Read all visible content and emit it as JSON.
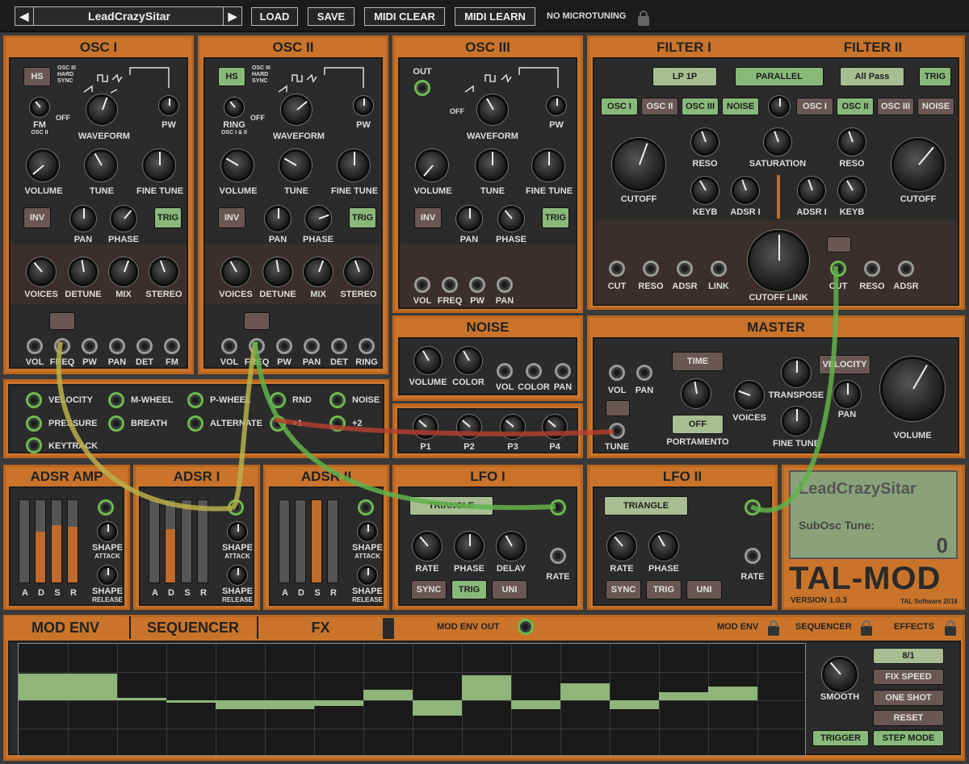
{
  "top": {
    "preset": "LeadCrazySitar",
    "load": "LOAD",
    "save": "SAVE",
    "midi_clear": "MIDI CLEAR",
    "midi_learn": "MIDI LEARN",
    "microtuning": "NO MICROTUNING",
    "prev": "◀",
    "next": "▶"
  },
  "osc1": {
    "title": "OSC I",
    "hs": "HS",
    "osc3sync": "OSC III HARD SYNC",
    "fm": "FM",
    "fm_sub": "OSC II",
    "waveform": "WAVEFORM",
    "off": "OFF",
    "pw": "PW",
    "volume": "VOLUME",
    "tune": "TUNE",
    "fine": "FINE TUNE",
    "inv": "INV",
    "pan": "PAN",
    "phase": "PHASE",
    "trig": "TRIG",
    "voices": "VOICES",
    "detune": "DETUNE",
    "mix": "MIX",
    "stereo": "STEREO",
    "j": [
      "VOL",
      "FREQ",
      "PW",
      "PAN",
      "DET",
      "FM"
    ]
  },
  "osc2": {
    "title": "OSC II",
    "hs": "HS",
    "osc3sync": "OSC III HARD SYNC",
    "ring": "RING",
    "ring_sub": "OSC I & II",
    "waveform": "WAVEFORM",
    "off": "OFF",
    "pw": "PW",
    "volume": "VOLUME",
    "tune": "TUNE",
    "fine": "FINE TUNE",
    "inv": "INV",
    "pan": "PAN",
    "phase": "PHASE",
    "trig": "TRIG",
    "voices": "VOICES",
    "detune": "DETUNE",
    "mix": "MIX",
    "stereo": "STEREO",
    "j": [
      "VOL",
      "FREQ",
      "PW",
      "PAN",
      "DET",
      "RING"
    ]
  },
  "osc3": {
    "title": "OSC III",
    "out": "OUT",
    "waveform": "WAVEFORM",
    "off": "OFF",
    "pw": "PW",
    "volume": "VOLUME",
    "tune": "TUNE",
    "fine": "FINE TUNE",
    "inv": "INV",
    "pan": "PAN",
    "phase": "PHASE",
    "trig": "TRIG",
    "j": [
      "VOL",
      "FREQ",
      "PW",
      "PAN"
    ]
  },
  "noise": {
    "title": "NOISE",
    "volume": "VOLUME",
    "color": "COLOR",
    "j": [
      "VOL",
      "COLOR",
      "PAN"
    ]
  },
  "filter": {
    "title1": "FILTER I",
    "title2": "FILTER II",
    "lp": "LP 1P",
    "parallel": "PARALLEL",
    "allpass": "All Pass",
    "trig": "TRIG",
    "src": [
      "OSC I",
      "OSC II",
      "OSC III",
      "NOISE"
    ],
    "reso": "RESO",
    "saturation": "SATURATION",
    "cutoff": "CUTOFF",
    "keyb": "KEYB",
    "adsr1": "ADSR I",
    "cutoff_link": "CUTOFF LINK",
    "j1": [
      "CUT",
      "RESO",
      "ADSR",
      "LINK"
    ],
    "j2": [
      "CUT",
      "RESO",
      "ADSR"
    ]
  },
  "mods": {
    "items": [
      "VELOCITY",
      "M-WHEEL",
      "P-WHEEL",
      "RND",
      "NOISE",
      "PRESSURE",
      "BREATH",
      "ALTERNATE",
      "+1",
      "+2",
      "KEYTRACK"
    ]
  },
  "params": {
    "p": [
      "P1",
      "P2",
      "P3",
      "P4"
    ]
  },
  "master": {
    "title": "MASTER",
    "vol": "VOL",
    "pan": "PAN",
    "time": "TIME",
    "velocity": "VELOCITY",
    "voices": "VOICES",
    "transpose": "TRANSPOSE",
    "off": "OFF",
    "portamento": "PORTAMENTO",
    "fine": "FINE TUNE",
    "tune": "TUNE",
    "volume": "VOLUME",
    "pan2": "PAN"
  },
  "adsr_amp": {
    "title": "ADSR AMP",
    "labels": [
      "A",
      "D",
      "S",
      "R"
    ],
    "shape_a": "SHAPE",
    "attack": "ATTACK",
    "shape_r": "SHAPE",
    "release": "RELEASE",
    "levels": [
      0,
      0.62,
      0.7,
      0.68
    ]
  },
  "adsr1": {
    "title": "ADSR I",
    "labels": [
      "A",
      "D",
      "S",
      "R"
    ],
    "shape_a": "SHAPE",
    "attack": "ATTACK",
    "shape_r": "SHAPE",
    "release": "RELEASE",
    "levels": [
      0,
      0.65,
      0.0,
      0.0
    ]
  },
  "adsr2": {
    "title": "ADSR II",
    "labels": [
      "A",
      "D",
      "S",
      "R"
    ],
    "shape_a": "SHAPE",
    "attack": "ATTACK",
    "shape_r": "SHAPE",
    "release": "RELEASE",
    "levels": [
      0,
      0,
      1.0,
      0
    ]
  },
  "lfo1": {
    "title": "LFO I",
    "wave": "TRIANGLE",
    "rate": "RATE",
    "phase": "PHASE",
    "delay": "DELAY",
    "rate2": "RATE",
    "sync": "SYNC",
    "trig": "TRIG",
    "uni": "UNI"
  },
  "lfo2": {
    "title": "LFO II",
    "wave": "TRIANGLE",
    "rate": "RATE",
    "phase": "PHASE",
    "rate2": "RATE",
    "sync": "SYNC",
    "trig": "TRIG",
    "uni": "UNI"
  },
  "display": {
    "name": "LeadCrazySitar",
    "param": "SubOsc Tune:",
    "value": "0",
    "logo": "TAL-MOD",
    "version": "VERSION 1.0.3",
    "company": "TAL Software 2018"
  },
  "bottom": {
    "tab_modenv": "MOD ENV",
    "tab_seq": "SEQUENCER",
    "tab_fx": "FX",
    "modenv_out": "MOD ENV OUT",
    "lock_modenv": "MOD ENV",
    "lock_seq": "SEQUENCER",
    "lock_fx": "EFFECTS"
  },
  "seq": {
    "steps": [
      0.47,
      0.47,
      0.04,
      -0.04,
      -0.16,
      -0.16,
      -0.1,
      0.18,
      -0.27,
      0.45,
      -0.16,
      0.3,
      -0.16,
      0.15,
      0.24
    ],
    "rate": "8/1",
    "fixspeed": "FIX SPEED",
    "oneshot": "ONE SHOT",
    "reset": "RESET",
    "smooth": "SMOOTH",
    "trigger": "TRIGGER",
    "stepmode": "STEP MODE"
  }
}
